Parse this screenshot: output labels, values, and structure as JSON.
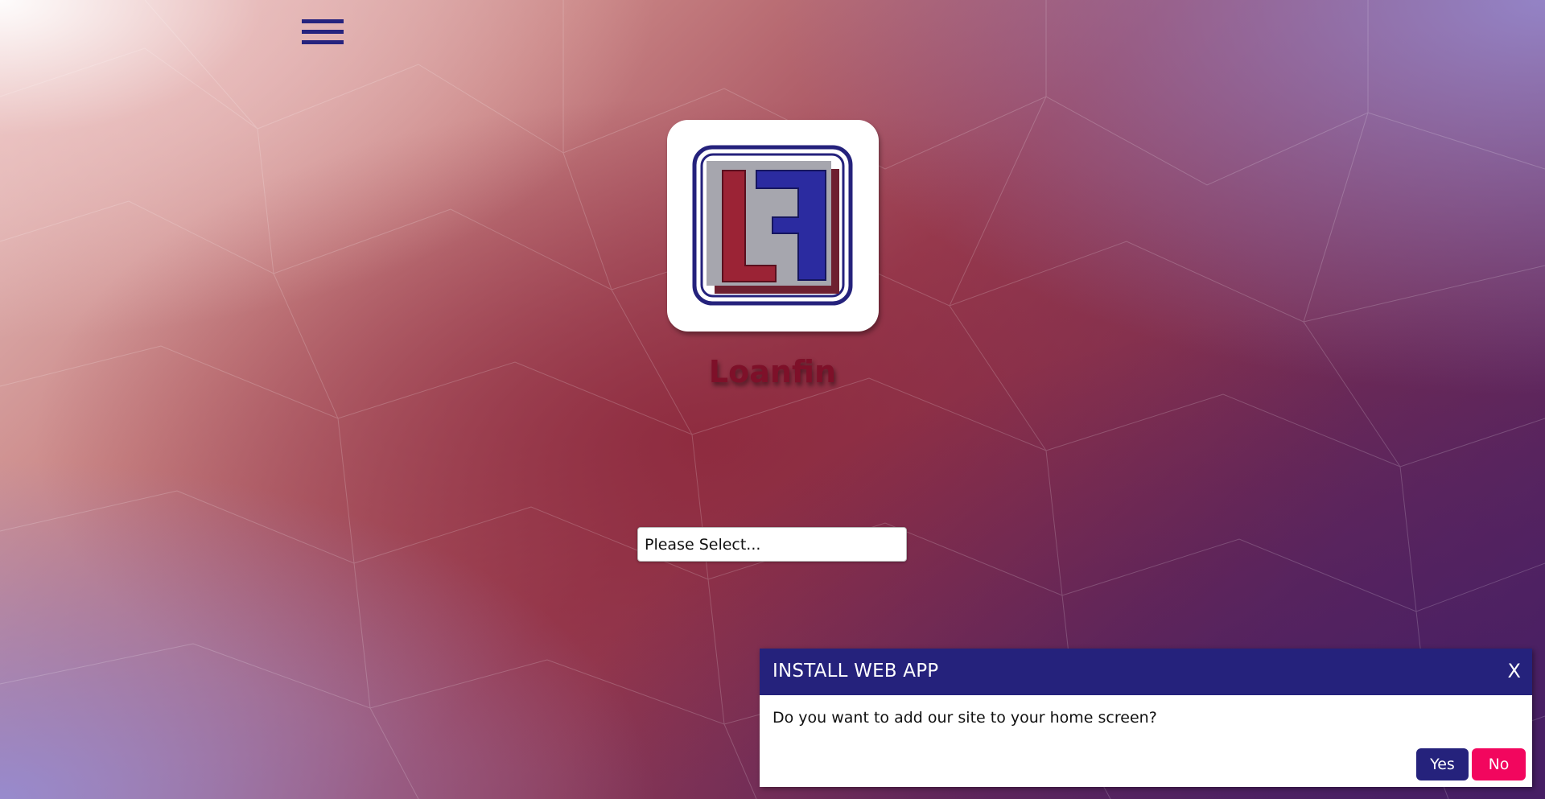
{
  "header": {
    "menu_icon": "hamburger-menu-icon"
  },
  "brand": {
    "name": "Loanfin",
    "logo_icon": "loanfin-logo-icon",
    "colors": {
      "navy": "#25227c",
      "crimson": "#7e1029",
      "logo_gray": "#a6a6ae",
      "logo_red": "#9b2335",
      "logo_blue": "#2b2ba0"
    }
  },
  "selector": {
    "selected": "Please Select..."
  },
  "install_prompt": {
    "title": "INSTALL WEB APP",
    "close_label": "X",
    "message": "Do you want to add our site to your home screen?",
    "yes_label": "Yes",
    "no_label": "No",
    "colors": {
      "header": "#25227c",
      "yes": "#25227c",
      "no": "#f2065e"
    }
  }
}
